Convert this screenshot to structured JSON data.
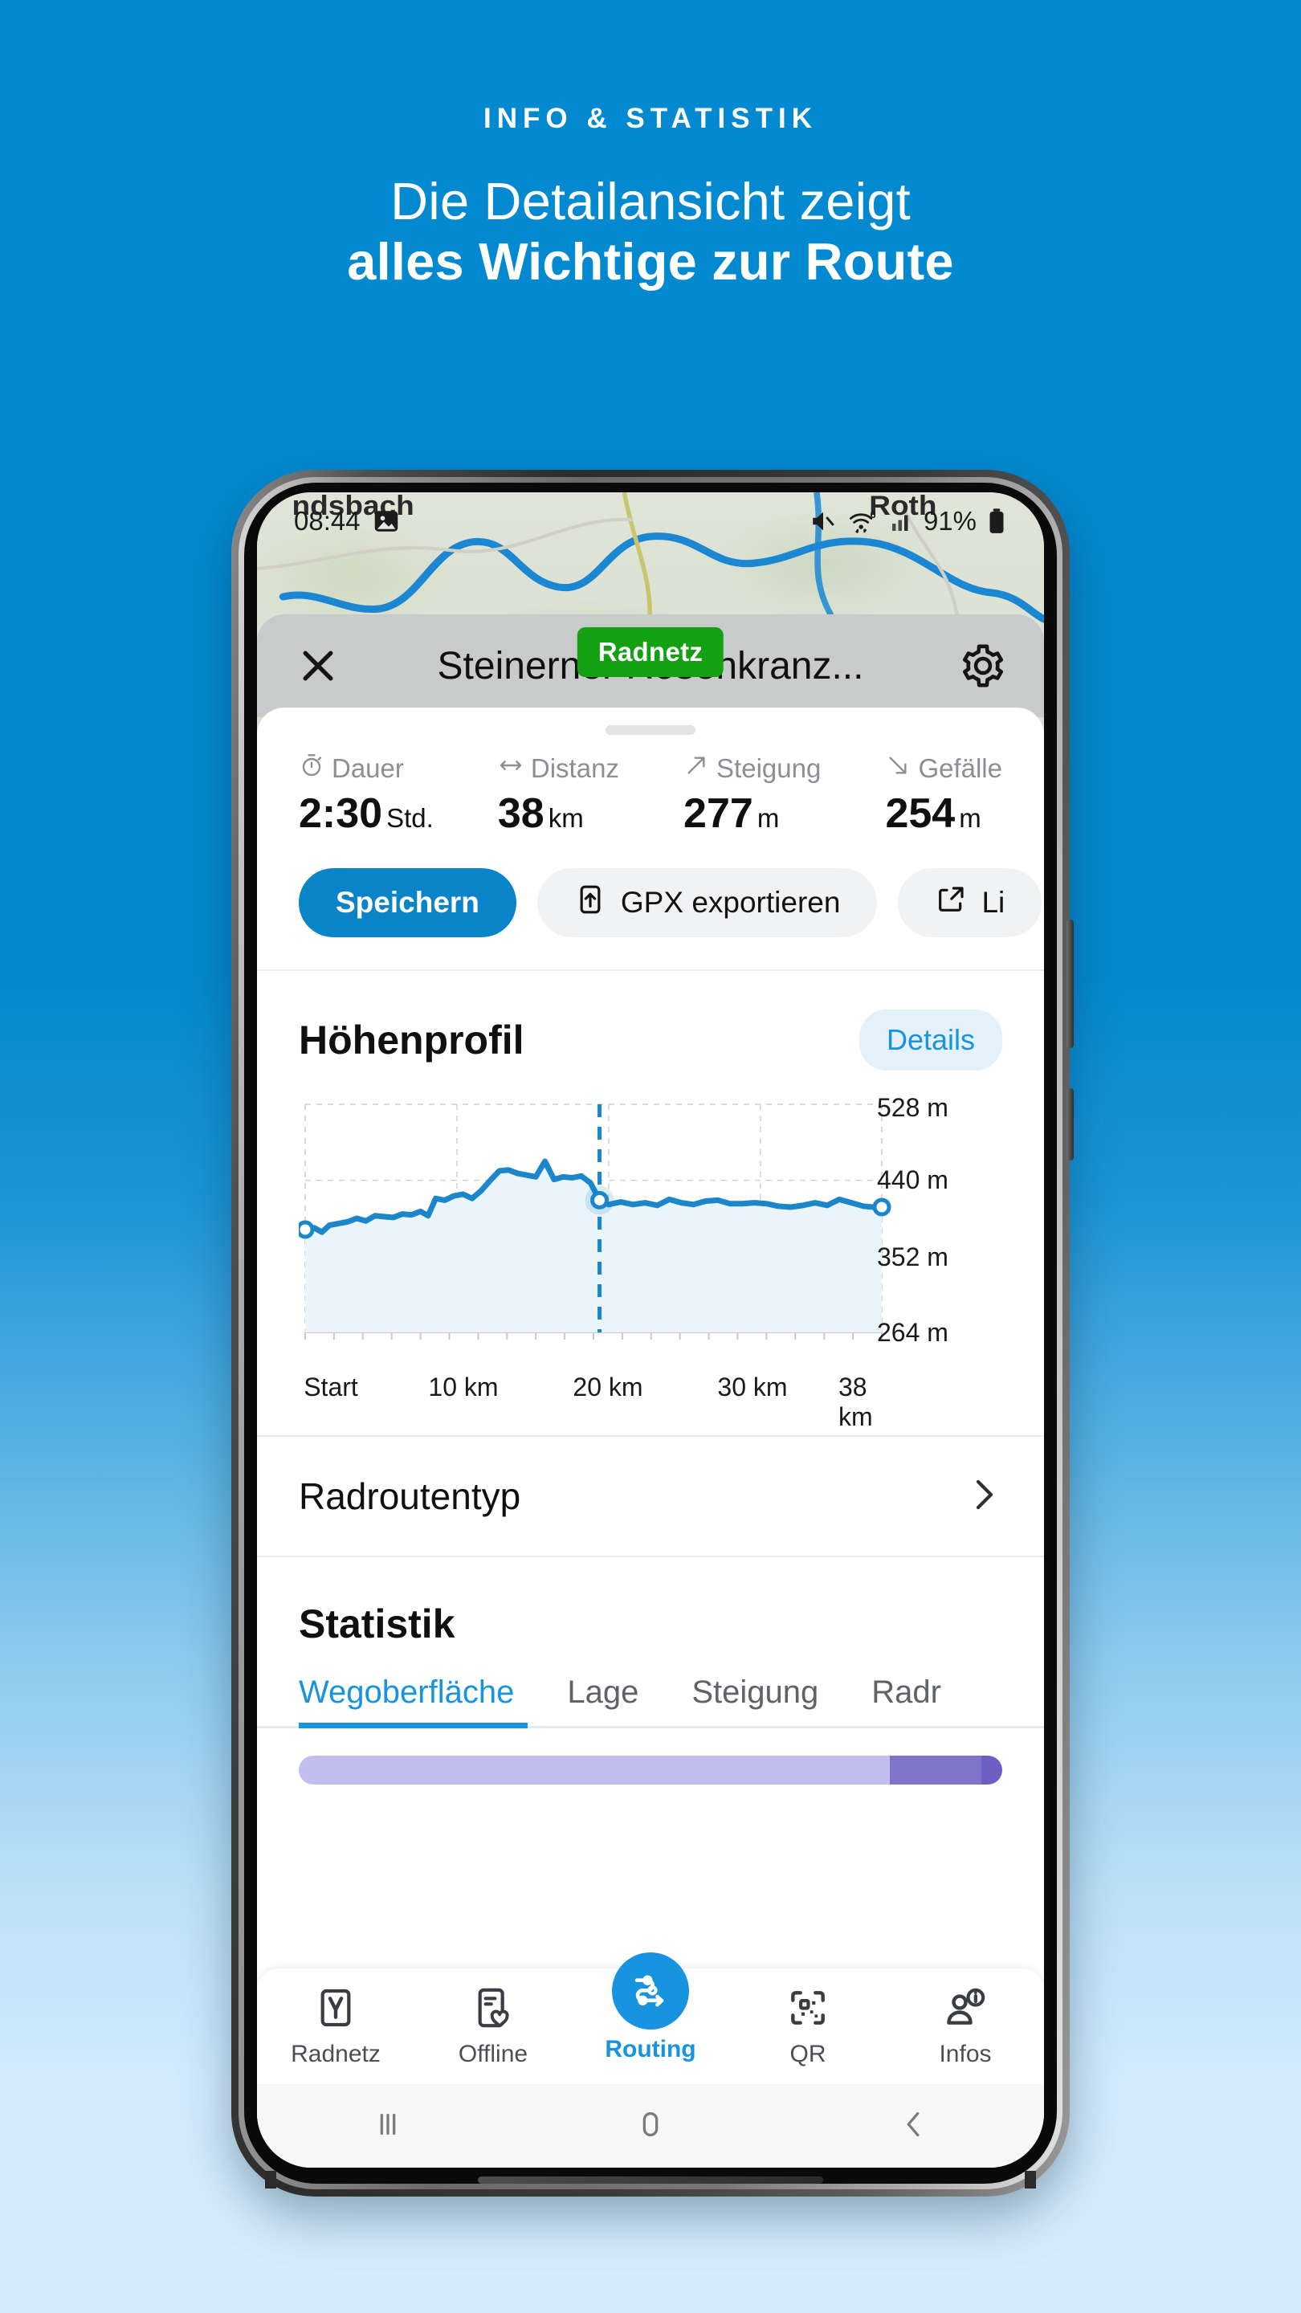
{
  "hero": {
    "eyebrow": "INFO & STATISTIK",
    "headline_line1": "Die Detailansicht zeigt",
    "headline_line2": "alles Wichtige zur Route",
    "bg_top_color": "#0389cf",
    "bg_bottom_color": "#d6ecfc"
  },
  "statusbar": {
    "time": "08:44",
    "photo_icon": "image-icon",
    "mute_icon": "volume-mute-icon",
    "wifi_icon": "wifi-icon",
    "wifi_badge": "6",
    "signal_icon": "cellular-signal-icon",
    "battery_percent": "91%",
    "battery_icon": "battery-full-icon"
  },
  "appbar": {
    "close_icon": "close-x-icon",
    "title": "Steinerner Rosenkranz...",
    "settings_icon": "gear-icon",
    "badge": "Radnetz",
    "badge_color": "#13a013"
  },
  "stats": [
    {
      "icon": "stopwatch-icon",
      "label": "Dauer",
      "value": "2:30",
      "unit": "Std."
    },
    {
      "icon": "arrows-horizontal-icon",
      "label": "Distanz",
      "value": "38",
      "unit": "km"
    },
    {
      "icon": "arrow-up-right-icon",
      "label": "Steigung",
      "value": "277",
      "unit": "m"
    },
    {
      "icon": "arrow-down-right-icon",
      "label": "Gefälle",
      "value": "254",
      "unit": "m"
    }
  ],
  "actions": [
    {
      "label": "Speichern",
      "icon": null,
      "style": "primary"
    },
    {
      "label": "GPX exportieren",
      "icon": "upload-icon",
      "style": "ghost"
    },
    {
      "label": "Li",
      "icon": "share-icon",
      "style": "ghost"
    }
  ],
  "elevation": {
    "title": "Höhenprofil",
    "details_label": "Details",
    "accent_color": "#1b86c9"
  },
  "chart_data": {
    "type": "area",
    "title": "Höhenprofil",
    "xlabel": "",
    "ylabel": "m",
    "ylim": [
      264,
      528
    ],
    "xlim": [
      0,
      38
    ],
    "grid": true,
    "ytick_labels": [
      "528 m",
      "440 m",
      "352 m",
      "264 m"
    ],
    "yticks": [
      528,
      440,
      352,
      264
    ],
    "xtick_labels": [
      "Start",
      "10 km",
      "20 km",
      "30 km",
      "38 km"
    ],
    "xticks": [
      0,
      10,
      20,
      30,
      38
    ],
    "marker_positions_km": [
      0,
      19.4,
      38
    ],
    "cursor_km": 19.4,
    "series": [
      {
        "name": "Höhe",
        "x": [
          0.0,
          0.6,
          1.1,
          1.6,
          2.2,
          2.8,
          3.4,
          4.0,
          4.6,
          5.2,
          5.8,
          6.4,
          7.0,
          7.6,
          8.1,
          8.6,
          9.2,
          9.8,
          10.4,
          11.0,
          11.6,
          12.2,
          12.8,
          13.4,
          14.0,
          14.6,
          15.2,
          15.8,
          16.4,
          17.0,
          17.6,
          18.2,
          18.8,
          19.4,
          20.0,
          20.8,
          21.6,
          22.4,
          23.2,
          24.0,
          24.8,
          25.6,
          26.4,
          27.2,
          28.0,
          28.8,
          29.6,
          30.4,
          31.2,
          32.0,
          32.8,
          33.6,
          34.4,
          35.2,
          36.0,
          36.8,
          37.4,
          38.0
        ],
        "values": [
          383,
          385,
          380,
          388,
          390,
          392,
          396,
          393,
          399,
          398,
          397,
          401,
          400,
          404,
          399,
          419,
          417,
          422,
          424,
          419,
          428,
          440,
          451,
          452,
          448,
          446,
          444,
          462,
          441,
          444,
          443,
          445,
          437,
          417,
          412,
          415,
          412,
          414,
          411,
          418,
          414,
          412,
          416,
          417,
          413,
          413,
          414,
          413,
          410,
          409,
          411,
          414,
          411,
          418,
          414,
          410,
          409,
          409
        ]
      }
    ],
    "line_color": "#1b86c9",
    "fill_color": "#eaf4fb"
  },
  "route_type_row": {
    "label": "Radroutentyp",
    "chevron_icon": "chevron-right-icon"
  },
  "statistik": {
    "title": "Statistik",
    "tabs": [
      {
        "label": "Wegoberfläche",
        "active": true
      },
      {
        "label": "Lage",
        "active": false
      },
      {
        "label": "Steigung",
        "active": false
      },
      {
        "label": "Radr",
        "active": false
      }
    ],
    "progress_segments": [
      {
        "percent": 84,
        "color": "#c2bfee"
      },
      {
        "percent": 13,
        "color": "#7f74c7"
      },
      {
        "percent": 3,
        "color": "#6c5fc4"
      }
    ]
  },
  "app_nav": [
    {
      "label": "Radnetz",
      "icon": "radnetz-y-icon",
      "active": false
    },
    {
      "label": "Offline",
      "icon": "offline-heart-icon",
      "active": false
    },
    {
      "label": "Routing",
      "icon": "routing-icon",
      "active": true
    },
    {
      "label": "QR",
      "icon": "qr-code-icon",
      "active": false
    },
    {
      "label": "Infos",
      "icon": "person-info-icon",
      "active": false
    }
  ],
  "android_nav": [
    {
      "icon": "recents-bars-icon"
    },
    {
      "icon": "home-pill-icon"
    },
    {
      "icon": "back-chevron-icon"
    }
  ]
}
